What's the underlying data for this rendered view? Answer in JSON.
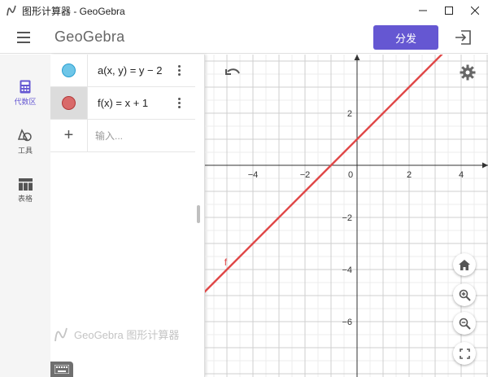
{
  "window": {
    "title": "图形计算器 - GeoGebra"
  },
  "header": {
    "logo": "GeoGebra",
    "share_label": "分发"
  },
  "rail": [
    {
      "label": "代数区",
      "icon": "calculator-icon",
      "active": true
    },
    {
      "label": "工具",
      "icon": "shapes-tool-icon",
      "active": false
    },
    {
      "label": "表格",
      "icon": "table-icon",
      "active": false
    }
  ],
  "algebra": {
    "rows": [
      {
        "expr": "a(x, y)  =  y − 2",
        "color": "#6ec6e8"
      },
      {
        "expr": "f(x)  =  x + 1",
        "color": "#d95f5f"
      }
    ],
    "input_placeholder": "输入...",
    "footer": "GeoGebra 图形计算器"
  },
  "graph": {
    "x_ticks": [
      "−4",
      "−2",
      "0",
      "2",
      "4"
    ],
    "y_ticks_pos": [
      "2"
    ],
    "y_ticks_neg": [
      "−2",
      "−4",
      "−6"
    ],
    "curve_label": "f",
    "line_color": "#e04848",
    "function": {
      "slope": 1,
      "intercept": 1
    }
  }
}
